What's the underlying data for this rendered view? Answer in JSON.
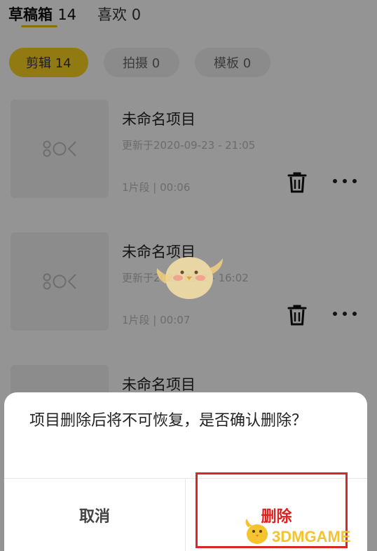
{
  "top_tabs": [
    {
      "label": "草稿箱",
      "count": "14"
    },
    {
      "label": "喜欢",
      "count": "0"
    }
  ],
  "filters": [
    {
      "label": "剪辑 14",
      "active": true
    },
    {
      "label": "拍摄 0",
      "active": false
    },
    {
      "label": "模板 0",
      "active": false
    }
  ],
  "projects": [
    {
      "title": "未命名项目",
      "updated": "更新于2020-09-23 - 21:05",
      "meta": "1片段 | 00:06"
    },
    {
      "title": "未命名项目",
      "updated": "更新于2020-09-2 - 16:02",
      "meta": "1片段 | 00:07"
    },
    {
      "title": "未命名项目"
    }
  ],
  "dialog": {
    "message": "项目删除后将不可恢复，是否确认删除？",
    "cancel_label": "取消",
    "delete_label": "删除"
  },
  "watermark": {
    "text": "3DMGAME"
  },
  "colors": {
    "accent_yellow": "#fcd21f",
    "delete_red": "#e0201c",
    "highlight_red": "#d9262b",
    "overlay": "rgba(0,0,0,0.42)"
  },
  "icons": {
    "thumb": "capcut-logo-icon",
    "delete": "trash-icon",
    "more": "more-dots-icon"
  }
}
